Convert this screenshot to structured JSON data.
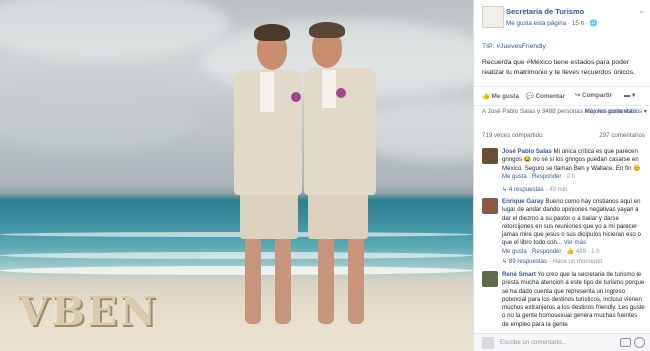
{
  "photo": {
    "watermark": "VBEN"
  },
  "page": {
    "name": "Secretaría de Turismo",
    "like_link": "Me gusta esta página",
    "time": "15 h"
  },
  "post": {
    "line1": "TIP: #JuevesFriendly",
    "line2": "Recuerda que #México tiene estados para poder realizar tu matrimonio y te lleves recuerdos únicos."
  },
  "actions": {
    "like": "Me gusta",
    "comment": "Comentar",
    "share": "Compartir"
  },
  "likes": {
    "text": "A José Pablo Salas y 3488 personas más les gusta esto.",
    "sort": "Mejores comentarios"
  },
  "stats": {
    "shares": "719 veces compartido",
    "comments": "297 comentarios"
  },
  "comments": [
    {
      "name": "José Pablo Salas",
      "text": "Mi única crítica es que parecen gringos 😂 no sé si los gringos puedan casarse en México. Seguro se llaman Ben y Wallace. En fin 😊",
      "like": "Me gusta",
      "reply": "Responder",
      "time": "2 h",
      "replies": "4 respuestas",
      "replies_time": "49 min"
    },
    {
      "name": "Enrique Garay",
      "text": "Bueno como hay cristianos aquí en lugar de andar dando opiniones negativas vayan a dar el diezmo a su pastor o a bailar y darse retorcijones en sus reuniones que yo a mi parecer jamas mire que jesus o sus dicipulos hicieran eso o que el libro todo con...",
      "more": "Ver más",
      "like": "Me gusta",
      "reply": "Responder",
      "likes_count": "489",
      "time": "1 h",
      "replies": "89 respuestas",
      "replies_time": "Hace un momento"
    },
    {
      "name": "René Smart",
      "text": "Yo creo que la secretaria de turismo le presta mucha atencion a este tipo de turismo porque se ha dado cuenta que representa un ingreso potencial para los destinos turisticos, incluso vienen muchos extranjeros a los destinos friendly. Les guste o no la gente homosexual genera muchas fuentes de empleo para la gente"
    }
  ],
  "write": {
    "placeholder": "Escribe un comentario..."
  },
  "colors": {
    "link": "#365899",
    "meta": "#616770"
  }
}
